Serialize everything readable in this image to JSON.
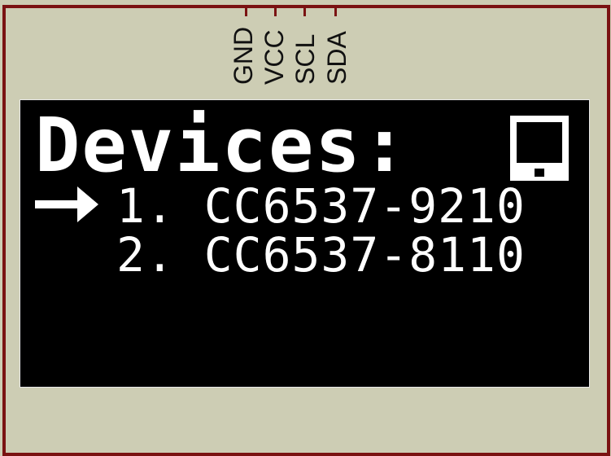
{
  "pins": [
    {
      "label": "GND"
    },
    {
      "label": "VCC"
    },
    {
      "label": "SCL"
    },
    {
      "label": "SDA"
    }
  ],
  "screen": {
    "title": "Devices:",
    "icon": "device-icon",
    "selected_index": 0,
    "items": [
      {
        "label": "1. CC6537-9210"
      },
      {
        "label": "2. CC6537-8110"
      }
    ]
  },
  "colors": {
    "board": "#cdcdb4",
    "border": "#7a1212",
    "screen": "#000000",
    "pixel": "#ffffff"
  }
}
